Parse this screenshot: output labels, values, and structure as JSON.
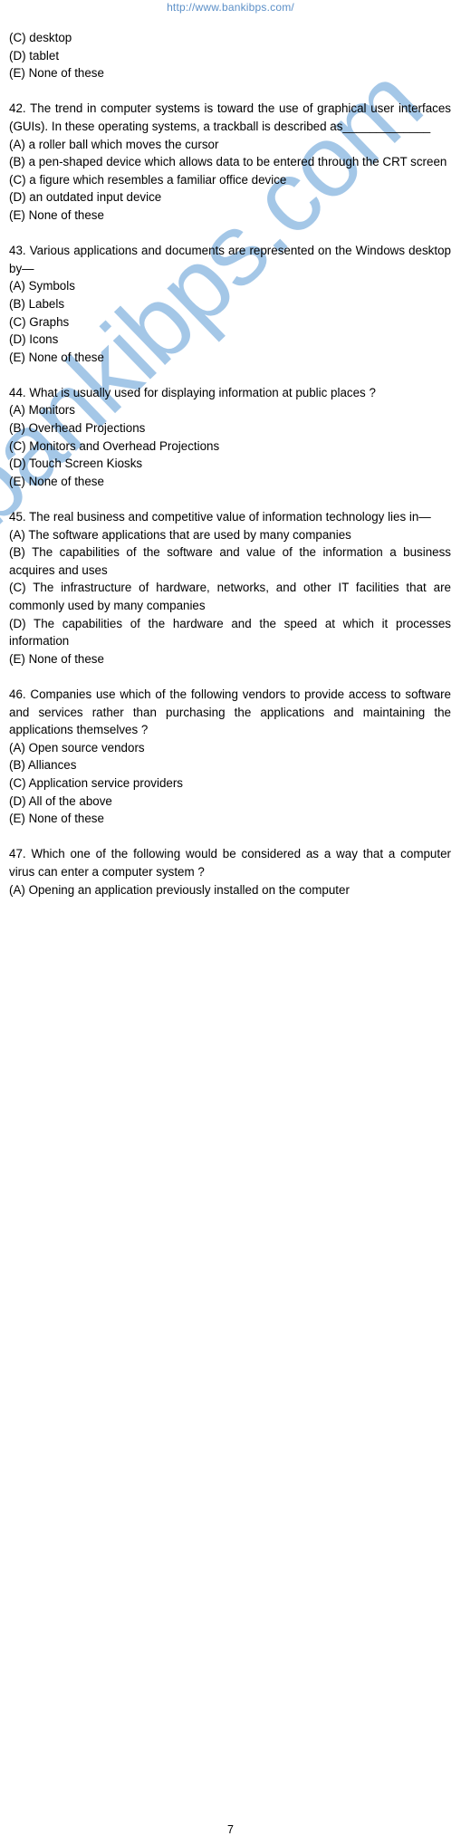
{
  "header": {
    "url": "http://www.bankibps.com/"
  },
  "watermark": {
    "text": "bankibps.com",
    "color": "#9dc3e6"
  },
  "carryover_options": [
    "(C) desktop",
    "(D) tablet",
    "(E) None of these"
  ],
  "questions": [
    {
      "number": "42",
      "text": "42. The trend in computer systems is toward the use of graphical user interfaces (GUIs). In these operating systems, a trackball is described as_____________",
      "options": [
        "(A) a roller ball which moves the cursor",
        "(B) a pen-shaped device which allows data to be entered through the CRT screen",
        "(C) a figure which resembles a familiar office device",
        "(D) an outdated input device",
        "(E) None of these"
      ]
    },
    {
      "number": "43",
      "text": "43. Various applications and documents are represented on the Windows desktop by—",
      "options": [
        "(A) Symbols",
        "(B) Labels",
        "(C) Graphs",
        "(D) Icons",
        "(E) None of these"
      ]
    },
    {
      "number": "44",
      "text": "44. What is usually used for displaying information at public places ?",
      "options": [
        "(A) Monitors",
        "(B) Overhead Projections",
        "(C) Monitors and Overhead Projections",
        "(D) Touch Screen Kiosks",
        "(E) None of these"
      ]
    },
    {
      "number": "45",
      "text": "45. The real business and competitive value of information technology lies in—",
      "options": [
        "(A) The software applications that are used by many companies",
        "(B) The capabilities of the software and value of the information a business acquires and uses",
        "(C) The infrastructure of hardware, networks, and other IT facilities that are commonly used by many companies",
        "(D) The capabilities of the hardware and the speed at which it processes information",
        "(E) None of these"
      ]
    },
    {
      "number": "46",
      "text": "46. Companies use which of the following vendors to provide access to software and services rather than purchasing the applications and maintaining the applications themselves ?",
      "options": [
        "(A) Open source vendors",
        "(B) Alliances",
        "(C) Application service providers",
        "(D) All of the above",
        "(E) None of these"
      ]
    },
    {
      "number": "47",
      "text": "47. Which one of the following would be considered as a way that a computer virus can enter a computer system ?",
      "options": [
        "(A) Opening an application previously installed on the computer"
      ]
    }
  ],
  "footer": {
    "page_number": "7"
  }
}
